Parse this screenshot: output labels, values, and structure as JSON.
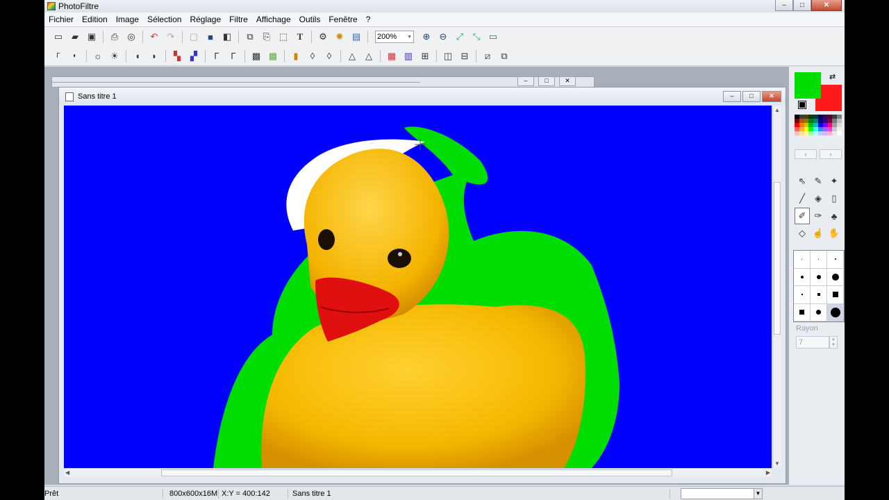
{
  "app": {
    "title": "PhotoFiltre",
    "window_controls": {
      "minimize": "–",
      "maximize": "□",
      "close": "✕"
    }
  },
  "menu": [
    "Fichier",
    "Edition",
    "Image",
    "Sélection",
    "Réglage",
    "Filtre",
    "Affichage",
    "Outils",
    "Fenêtre",
    "?"
  ],
  "toolbar1": {
    "icons": [
      "new-icon",
      "open-icon",
      "save-icon",
      "print-icon",
      "scan-icon",
      "undo-icon",
      "redo-icon",
      "transparency-icon",
      "color-icon",
      "layer-icon",
      "copy-icon",
      "paste-icon",
      "selection-icon",
      "text-icon",
      "stamp-icon",
      "plugin-icon",
      "window-icon"
    ],
    "zoom_value": "200%",
    "zoom_icons": [
      "zoom-in-icon",
      "zoom-out-icon",
      "fit-icon",
      "actual-size-icon",
      "fullscreen-icon"
    ]
  },
  "toolbar2": {
    "icons": [
      "auto-level-icon",
      "auto-contrast-icon",
      "brightness-up-icon",
      "brightness-down-icon",
      "contrast-down-icon",
      "contrast-up-icon",
      "saturation-down-icon",
      "saturation-up-icon",
      "gamma-down-icon",
      "gamma-up-icon",
      "blur-icon",
      "sharpen-icon",
      "soften-icon",
      "noise-icon",
      "drop-icon",
      "drop-plus-icon",
      "triangle-icon",
      "triangle-sharp-icon",
      "rgb-icon",
      "gradient-icon",
      "mirror-icon",
      "flip-h-icon",
      "flip-v-icon",
      "rotate-icon",
      "resize-icon"
    ]
  },
  "background_window": {
    "controls": [
      "–",
      "□",
      "✕"
    ]
  },
  "document": {
    "title": "Sans titre 1",
    "controls": [
      "–",
      "□",
      "✕"
    ],
    "canvas_bg": "#0000ff"
  },
  "colors": {
    "foreground": "#00dd00",
    "background": "#ff1a1a",
    "swap_icon": "⇄"
  },
  "palette": [
    "#000000",
    "#3b3b3b",
    "#5a3a00",
    "#004000",
    "#003c3c",
    "#00005a",
    "#3a0060",
    "#5a0030",
    "#3c3c3c",
    "#808080",
    "#800000",
    "#c05000",
    "#808000",
    "#008000",
    "#008080",
    "#000080",
    "#400080",
    "#800040",
    "#7a7a7a",
    "#c0c0c0",
    "#ff0000",
    "#ff8000",
    "#c8c800",
    "#00c000",
    "#00c0c0",
    "#0000ff",
    "#8000ff",
    "#ff0080",
    "#a0a0a0",
    "#dcdcdc",
    "#ff6060",
    "#ffb040",
    "#ffff00",
    "#00ff00",
    "#40ffff",
    "#4080ff",
    "#a060ff",
    "#ff40c0",
    "#c8c8c8",
    "#f0f0f0",
    "#ffc0c0",
    "#ffe0a0",
    "#ffffa0",
    "#a0ffa0",
    "#b0ffff",
    "#b0d0ff",
    "#d8b0ff",
    "#ffb0e0",
    "#e8e8e8",
    "#ffffff"
  ],
  "palette_nav": {
    "prev": "‹",
    "next": "›"
  },
  "tools": [
    "pointer-icon",
    "eyedropper-icon",
    "magic-wand-icon",
    "line-icon",
    "fill-icon",
    "spray-icon",
    "brush-icon",
    "advanced-brush-icon",
    "clone-stamp-icon",
    "blur-drop-icon",
    "smudge-icon",
    "hand-icon"
  ],
  "tool_glyphs": [
    "⇖",
    "✎",
    "✦",
    "╱",
    "◈",
    "▯",
    "✐",
    "✑",
    "♣",
    "◇",
    "☝",
    "✋"
  ],
  "brush_grid_selected": 11,
  "rayon": {
    "label": "Rayon",
    "value": "7"
  },
  "status": {
    "ready": "Prêt",
    "size": "800x600x16M",
    "coords": "X:Y = 400:142",
    "doc": "Sans titre 1"
  }
}
